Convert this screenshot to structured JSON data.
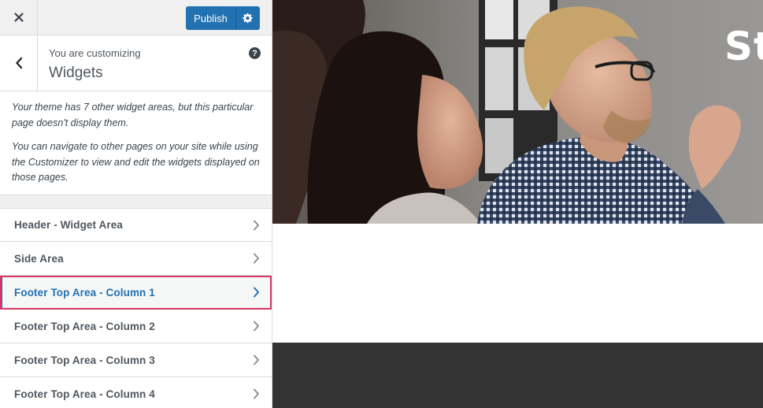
{
  "topbar": {
    "close_label": "✕",
    "publish_label": "Publish",
    "settings_icon": "gear-icon"
  },
  "section": {
    "customizing_label": "You are customizing",
    "title": "Widgets",
    "help_label": "?"
  },
  "notice": {
    "paragraph_1": "Your theme has 7 other widget areas, but this particular page doesn't display them.",
    "paragraph_2": "You can navigate to other pages on your site while using the Customizer to view and edit the widgets displayed on those pages."
  },
  "widget_areas": [
    {
      "label": "Header - Widget Area"
    },
    {
      "label": "Side Area"
    },
    {
      "label": "Footer Top Area - Column 1"
    },
    {
      "label": "Footer Top Area - Column 2"
    },
    {
      "label": "Footer Top Area - Column 3"
    },
    {
      "label": "Footer Top Area - Column 4"
    }
  ],
  "active_widget_area": "Footer Top Area - Column 1",
  "preview": {
    "hero_title": "St"
  },
  "colors": {
    "accent": "#2271b1",
    "highlight_outline": "#d63864",
    "footer_background": "#333333",
    "sidebar_background": "#f0f0f1"
  }
}
